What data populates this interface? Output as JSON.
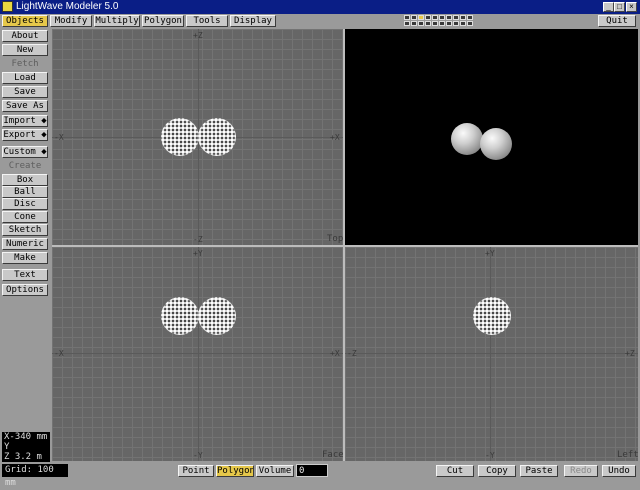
{
  "window": {
    "title": "LightWave Modeler 5.0",
    "minimize": "_",
    "maximize": "□",
    "close": "×"
  },
  "tabs": [
    "Objects",
    "Modify",
    "Multiply",
    "Polygon",
    "Tools",
    "Display"
  ],
  "active_tab": "Objects",
  "quit_label": "Quit",
  "sidebar": {
    "about": "About",
    "new": "New",
    "fetch": "Fetch",
    "load": "Load",
    "save": "Save",
    "save_as": "Save As",
    "import": "Import ◆",
    "export": "Export ◆",
    "custom": "Custom ◆",
    "create_header": "Create",
    "box": "Box",
    "ball": "Ball",
    "disc": "Disc",
    "cone": "Cone",
    "sketch": "Sketch",
    "numeric": "Numeric",
    "make": "Make",
    "text": "Text",
    "options": "Options"
  },
  "viewports": {
    "top": {
      "name": "Top",
      "axis_top": "+Z",
      "axis_bottom": "-Z",
      "axis_left": "-X",
      "axis_right": "+X"
    },
    "face": {
      "name": "Face",
      "axis_top": "+Y",
      "axis_bottom": "-Y",
      "axis_left": "-X",
      "axis_right": "+X"
    },
    "left": {
      "name": "Left",
      "axis_top": "+Y",
      "axis_bottom": "-Y",
      "axis_left": "-Z",
      "axis_right": "+Z"
    }
  },
  "coordinates": {
    "x": "X-340 mm",
    "y": "Y",
    "z": "Z 3.2 m"
  },
  "grid_label": "Grid: 100 mm",
  "select_modes": [
    "Point",
    "Polygon",
    "Volume"
  ],
  "active_mode": "Polygon",
  "numeric_value": "0",
  "edit_buttons": {
    "cut": "Cut",
    "copy": "Copy",
    "paste": "Paste",
    "redo": "Redo",
    "undo": "Undo"
  },
  "colors": {
    "title_bar": "#0a1e86",
    "active_button": "#e6c84a",
    "viewport_bg": "#666666",
    "perspective_bg": "#000000"
  }
}
